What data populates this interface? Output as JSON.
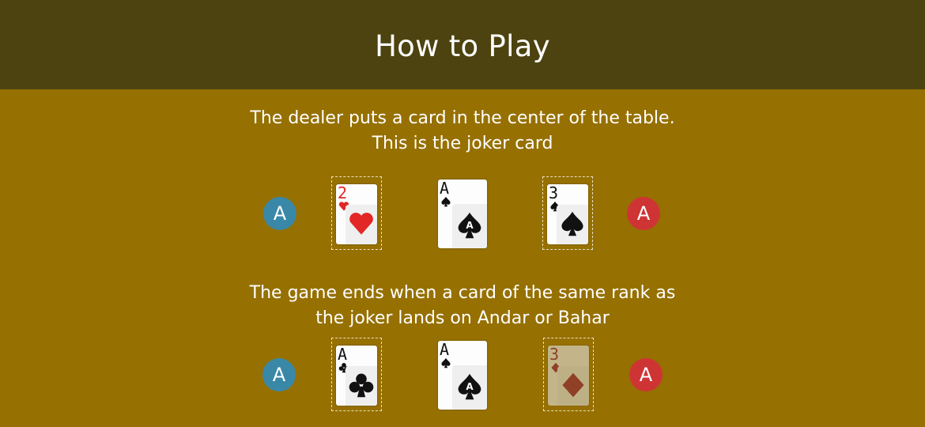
{
  "header": {
    "title": "How to Play"
  },
  "step1": {
    "caption_line1": "The dealer puts a card in  the center of the table.",
    "caption_line2": "This is the joker card",
    "andar_chip": "A",
    "bahar_chip": "A",
    "andar_card": {
      "rank": "2",
      "suit": "hearts"
    },
    "joker_card": {
      "rank": "A",
      "suit": "spades"
    },
    "bahar_card": {
      "rank": "3",
      "suit": "spades"
    }
  },
  "step2": {
    "caption_line1": "The game ends when a card of the same rank as",
    "caption_line2": "the joker lands on Andar or Bahar",
    "andar_chip": "A",
    "bahar_chip": "A",
    "andar_card": {
      "rank": "A",
      "suit": "clubs"
    },
    "joker_card": {
      "rank": "A",
      "suit": "spades"
    },
    "bahar_card": {
      "rank": "3",
      "suit": "diamonds"
    }
  },
  "colors": {
    "background": "#967000",
    "header": "#4d4310",
    "andar_chip": "#3a88a7",
    "bahar_chip": "#cf3434"
  }
}
